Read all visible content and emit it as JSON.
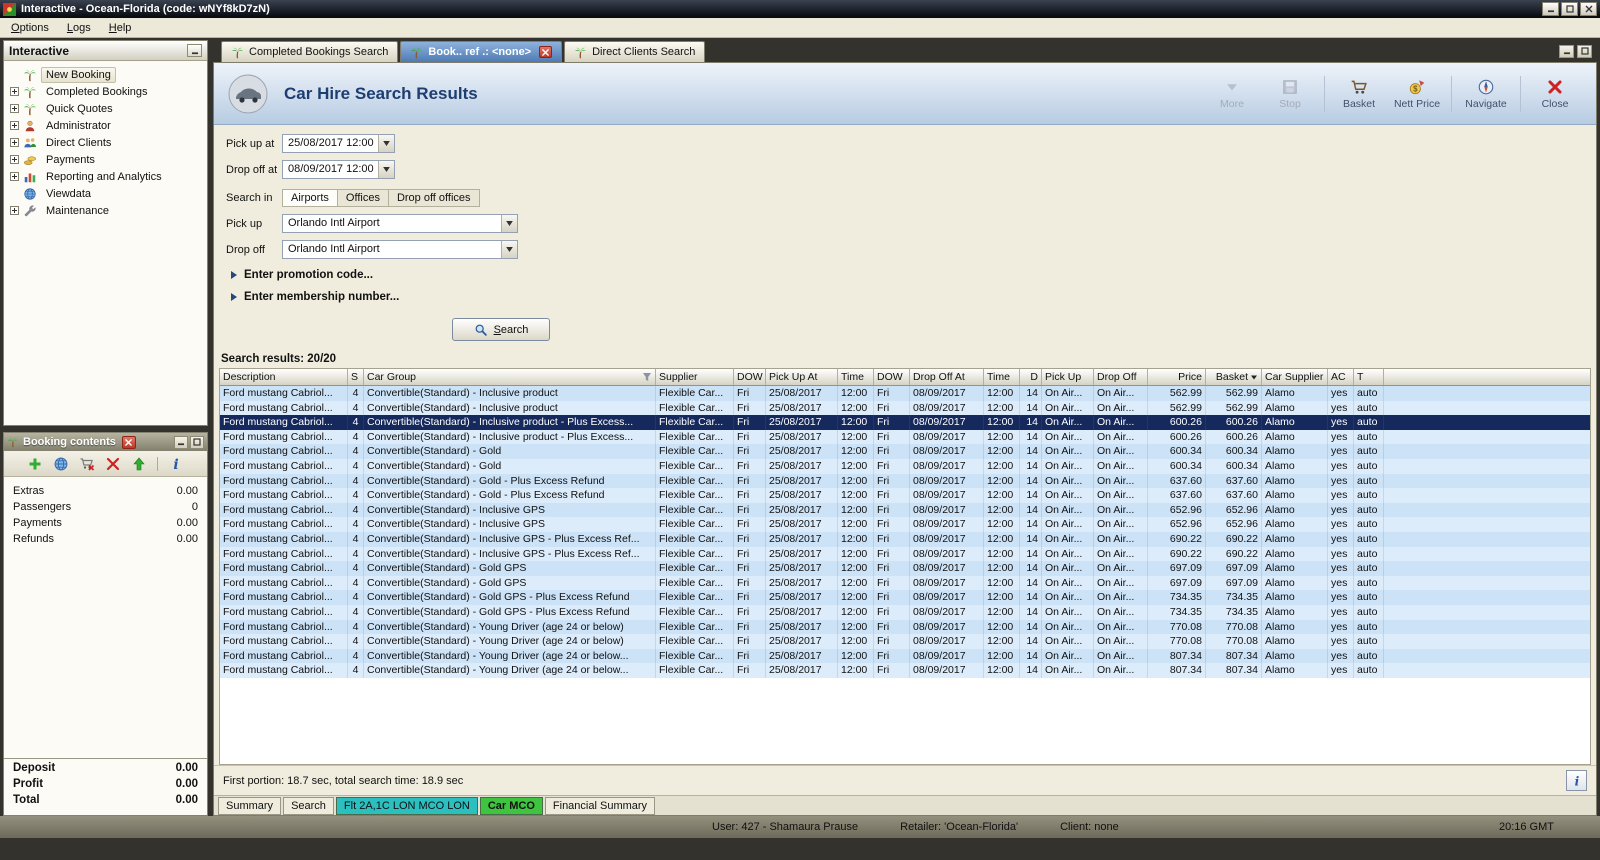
{
  "window": {
    "title": "Interactive - Ocean-Florida (code: wNYf8kD7zN)"
  },
  "menu": [
    "Options",
    "Logs",
    "Help"
  ],
  "sidebar": {
    "title": "Interactive",
    "items": [
      {
        "label": "New Booking",
        "icon": "palm-icon",
        "expandable": false,
        "selected": true
      },
      {
        "label": "Completed Bookings",
        "icon": "palm-icon",
        "expandable": true,
        "selected": false
      },
      {
        "label": "Quick Quotes",
        "icon": "palm-icon",
        "expandable": true,
        "selected": false
      },
      {
        "label": "Administrator",
        "icon": "user-icon",
        "expandable": true,
        "selected": false
      },
      {
        "label": "Direct Clients",
        "icon": "users-icon",
        "expandable": true,
        "selected": false
      },
      {
        "label": "Payments",
        "icon": "coins-icon",
        "expandable": true,
        "selected": false
      },
      {
        "label": "Reporting and Analytics",
        "icon": "chart-icon",
        "expandable": true,
        "selected": false
      },
      {
        "label": "Viewdata",
        "icon": "globe-icon",
        "expandable": false,
        "selected": false
      },
      {
        "label": "Maintenance",
        "icon": "wrench-icon",
        "expandable": true,
        "selected": false
      }
    ]
  },
  "booking_contents": {
    "title": "Booking contents",
    "toolbar": [
      {
        "icon": "add-icon"
      },
      {
        "icon": "globe-icon"
      },
      {
        "icon": "basket-remove-icon"
      },
      {
        "icon": "delete-icon"
      },
      {
        "icon": "promote-icon"
      },
      {
        "sep": true
      },
      {
        "icon": "info-icon"
      }
    ],
    "rows": [
      {
        "label": "Extras",
        "value": "0.00"
      },
      {
        "label": "Passengers",
        "value": "0"
      },
      {
        "label": "Payments",
        "value": "0.00"
      },
      {
        "label": "Refunds",
        "value": "0.00"
      }
    ],
    "summary": [
      {
        "label": "Deposit",
        "value": "0.00"
      },
      {
        "label": "Profit",
        "value": "0.00"
      },
      {
        "label": "Total",
        "value": "0.00"
      }
    ]
  },
  "tabs": [
    {
      "label": "Completed Bookings Search",
      "active": false,
      "closable": false
    },
    {
      "label": "Book.. ref .: <none>",
      "active": true,
      "closable": true
    },
    {
      "label": "Direct Clients Search",
      "active": false,
      "closable": false
    }
  ],
  "header": {
    "title": "Car Hire Search Results",
    "actions": [
      {
        "label": "More",
        "icon": "more-icon",
        "disabled": true
      },
      {
        "label": "Stop",
        "icon": "stop-icon",
        "disabled": true
      },
      {
        "label": "Basket",
        "icon": "basket-icon",
        "sep_before": true
      },
      {
        "label": "Nett Price",
        "icon": "nett-price-icon"
      },
      {
        "label": "Navigate",
        "icon": "navigate-icon",
        "sep_before": true
      },
      {
        "label": "Close",
        "icon": "close-icon",
        "sep_before": true
      }
    ]
  },
  "form": {
    "pickup_at_label": "Pick up at",
    "pickup_at_value": "25/08/2017 12:00",
    "dropoff_at_label": "Drop off at",
    "dropoff_at_value": "08/09/2017 12:00",
    "search_in_label": "Search in",
    "search_in_options": [
      "Airports",
      "Offices",
      "Drop off offices"
    ],
    "search_in_selected": "Airports",
    "pickup_label": "Pick up",
    "pickup_value": "Orlando Intl Airport",
    "dropoff_label": "Drop off",
    "dropoff_value": "Orlando Intl Airport",
    "promo_expander": "Enter promotion code...",
    "membership_expander": "Enter membership number...",
    "search_button": "Search"
  },
  "results": {
    "count_label": "Search results: 20/20",
    "columns": [
      "Description",
      "S",
      "Car Group",
      "Supplier",
      "DOW",
      "Pick Up At",
      "Time",
      "DOW",
      "Drop Off At",
      "Time",
      "D",
      "Pick Up",
      "Drop Off",
      "Price",
      "Basket",
      "Car Supplier",
      "AC",
      "T"
    ],
    "common": {
      "description": "Ford mustang Cabriol...",
      "s": "4",
      "supplier": "Flexible Car...",
      "pickup_dow": "Fri",
      "pickup_date": "25/08/2017",
      "pickup_time": "12:00",
      "dropoff_dow": "Fri",
      "dropoff_date": "08/09/2017",
      "dropoff_time": "12:00",
      "days": "14",
      "pickup_office": "On Air...",
      "dropoff_office": "On Air...",
      "car_supplier": "Alamo",
      "ac": "yes",
      "transmission": "auto"
    },
    "rows": [
      {
        "car_group": "Convertible(Standard) - Inclusive product",
        "price": "562.99",
        "basket": "562.99"
      },
      {
        "car_group": "Convertible(Standard) - Inclusive product",
        "price": "562.99",
        "basket": "562.99"
      },
      {
        "car_group": "Convertible(Standard) - Inclusive product - Plus Excess...",
        "price": "600.26",
        "basket": "600.26"
      },
      {
        "car_group": "Convertible(Standard) - Inclusive product - Plus Excess...",
        "price": "600.26",
        "basket": "600.26"
      },
      {
        "car_group": "Convertible(Standard) - Gold",
        "price": "600.34",
        "basket": "600.34"
      },
      {
        "car_group": "Convertible(Standard) - Gold",
        "price": "600.34",
        "basket": "600.34"
      },
      {
        "car_group": "Convertible(Standard) - Gold - Plus Excess Refund",
        "price": "637.60",
        "basket": "637.60"
      },
      {
        "car_group": "Convertible(Standard) - Gold - Plus Excess Refund",
        "price": "637.60",
        "basket": "637.60"
      },
      {
        "car_group": "Convertible(Standard) - Inclusive GPS",
        "price": "652.96",
        "basket": "652.96"
      },
      {
        "car_group": "Convertible(Standard) - Inclusive GPS",
        "price": "652.96",
        "basket": "652.96"
      },
      {
        "car_group": "Convertible(Standard) - Inclusive GPS - Plus Excess Ref...",
        "price": "690.22",
        "basket": "690.22"
      },
      {
        "car_group": "Convertible(Standard) - Inclusive GPS - Plus Excess Ref...",
        "price": "690.22",
        "basket": "690.22"
      },
      {
        "car_group": "Convertible(Standard) - Gold GPS",
        "price": "697.09",
        "basket": "697.09"
      },
      {
        "car_group": "Convertible(Standard) - Gold GPS",
        "price": "697.09",
        "basket": "697.09"
      },
      {
        "car_group": "Convertible(Standard) - Gold GPS - Plus Excess Refund",
        "price": "734.35",
        "basket": "734.35"
      },
      {
        "car_group": "Convertible(Standard) - Gold GPS - Plus Excess Refund",
        "price": "734.35",
        "basket": "734.35"
      },
      {
        "car_group": "Convertible(Standard) - Young Driver (age 24 or below)",
        "price": "770.08",
        "basket": "770.08"
      },
      {
        "car_group": "Convertible(Standard) - Young Driver (age 24 or below)",
        "price": "770.08",
        "basket": "770.08"
      },
      {
        "car_group": "Convertible(Standard) - Young Driver (age 24 or below...",
        "price": "807.34",
        "basket": "807.34"
      },
      {
        "car_group": "Convertible(Standard) - Young Driver (age 24 or below...",
        "price": "807.34",
        "basket": "807.34"
      }
    ],
    "selected_index": 2,
    "status": "First portion: 18.7 sec, total search time: 18.9 sec"
  },
  "bottom_tabs": [
    {
      "label": "Summary",
      "active": false
    },
    {
      "label": "Search",
      "active": false
    },
    {
      "label": "Flt 2A,1C LON MCO LON",
      "color": "#2bbfbf",
      "active": false
    },
    {
      "label": "Car MCO",
      "color": "#3ec43e",
      "active": true
    },
    {
      "label": "Financial Summary",
      "active": false
    }
  ],
  "statusbar": {
    "user": "User: 427 - Shamaura Prause",
    "retailer": "Retailer: 'Ocean-Florida'",
    "client": "Client: none",
    "time": "20:16 GMT"
  }
}
